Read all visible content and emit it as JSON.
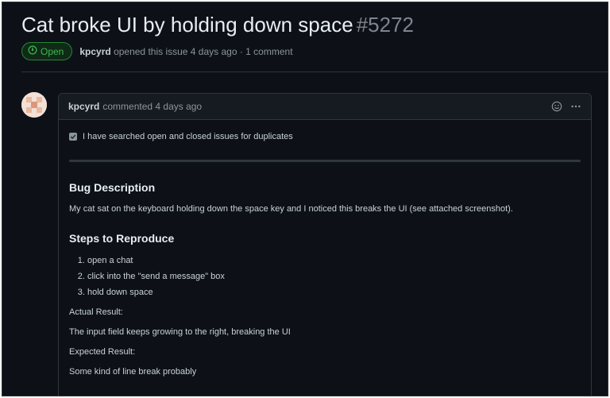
{
  "issue": {
    "title": "Cat broke UI by holding down space",
    "number": "#5272",
    "state": "Open",
    "author": "kpcyrd",
    "meta_suffix": "opened this issue 4 days ago · 1 comment"
  },
  "comment": {
    "author": "kpcyrd",
    "timestamp": "commented 4 days ago",
    "checkbox_label": "I have searched open and closed issues for duplicates",
    "checkbox_checked": true,
    "bug_heading": "Bug Description",
    "bug_text": "My cat sat on the keyboard holding down the space key and I noticed this breaks the UI (see attached screenshot).",
    "steps_heading": "Steps to Reproduce",
    "steps": [
      "open a chat",
      "click into the \"send a message\" box",
      "hold down space"
    ],
    "actual_label": "Actual Result:",
    "actual_text": "The input field keeps growing to the right, breaking the UI",
    "expected_label": "Expected Result:",
    "expected_text": "Some kind of line break probably"
  },
  "icons": {
    "state": "issue-opened-icon",
    "reaction": "smiley-icon",
    "menu": "kebab-horizontal-icon",
    "check": "checkmark-icon"
  },
  "colors": {
    "background": "#0d1117",
    "open_green": "#3fb950",
    "text": "#c9d1d9",
    "muted": "#8b949e",
    "border": "#30363d"
  }
}
